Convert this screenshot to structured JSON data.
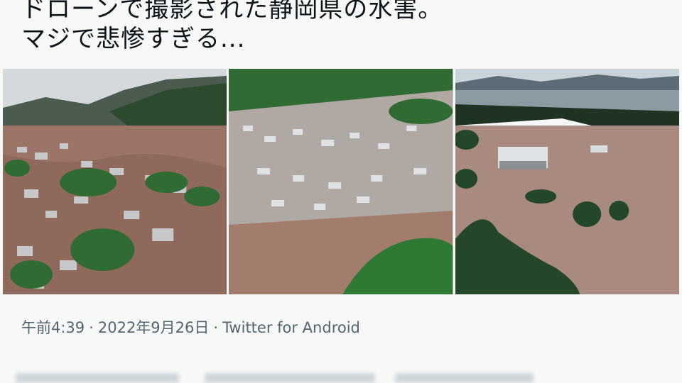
{
  "tweet": {
    "text_line1": "ドローンで撮影された静岡県の水害。",
    "text_line2": "マジで悲惨すぎる...",
    "time": "午前4:39",
    "date": "2022年9月26日",
    "client": "Twitter for Android",
    "separator": "·"
  },
  "media": {
    "count": 3,
    "icons": [
      "flooded-town-photo",
      "flooded-neighborhood-photo",
      "flooded-buildings-photo"
    ]
  },
  "colors": {
    "background": "#f7f9f9",
    "text": "#0f1419",
    "meta": "#536471",
    "flood_water": "#9c6e5a",
    "forest": "#2f6b32"
  }
}
